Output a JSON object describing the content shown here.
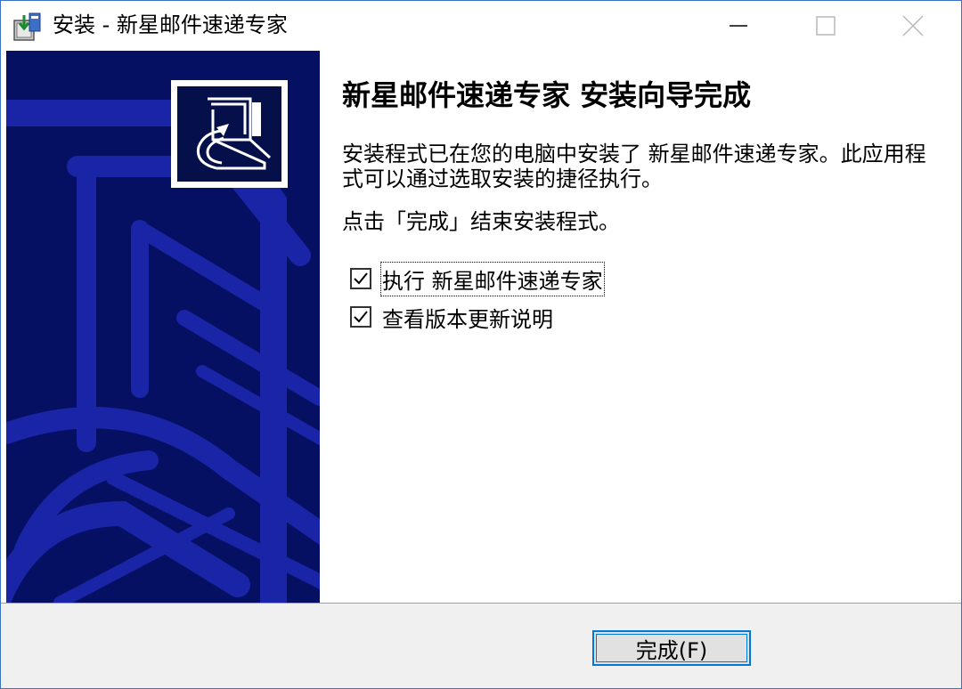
{
  "window": {
    "title": "安装 - 新星邮件速递专家"
  },
  "controls": {
    "minimize_icon": "minimize-icon",
    "maximize_icon": "maximize-icon",
    "close_icon": "close-icon"
  },
  "banner": {
    "logo_icon": "computer-install-icon",
    "background_color": "#061063",
    "accent_color": "#1a24a6"
  },
  "content": {
    "heading": "新星邮件速递专家 安装向导完成",
    "paragraph1": "安装程式已在您的电脑中安装了 新星邮件速递专家。此应用程式可以通过选取安装的捷径执行。",
    "paragraph2": "点击「完成」结束安装程式。",
    "checkboxes": [
      {
        "label": "执行 新星邮件速递专家",
        "checked": true
      },
      {
        "label": "查看版本更新说明",
        "checked": true
      }
    ]
  },
  "footer": {
    "finish_button": "完成(F)"
  }
}
